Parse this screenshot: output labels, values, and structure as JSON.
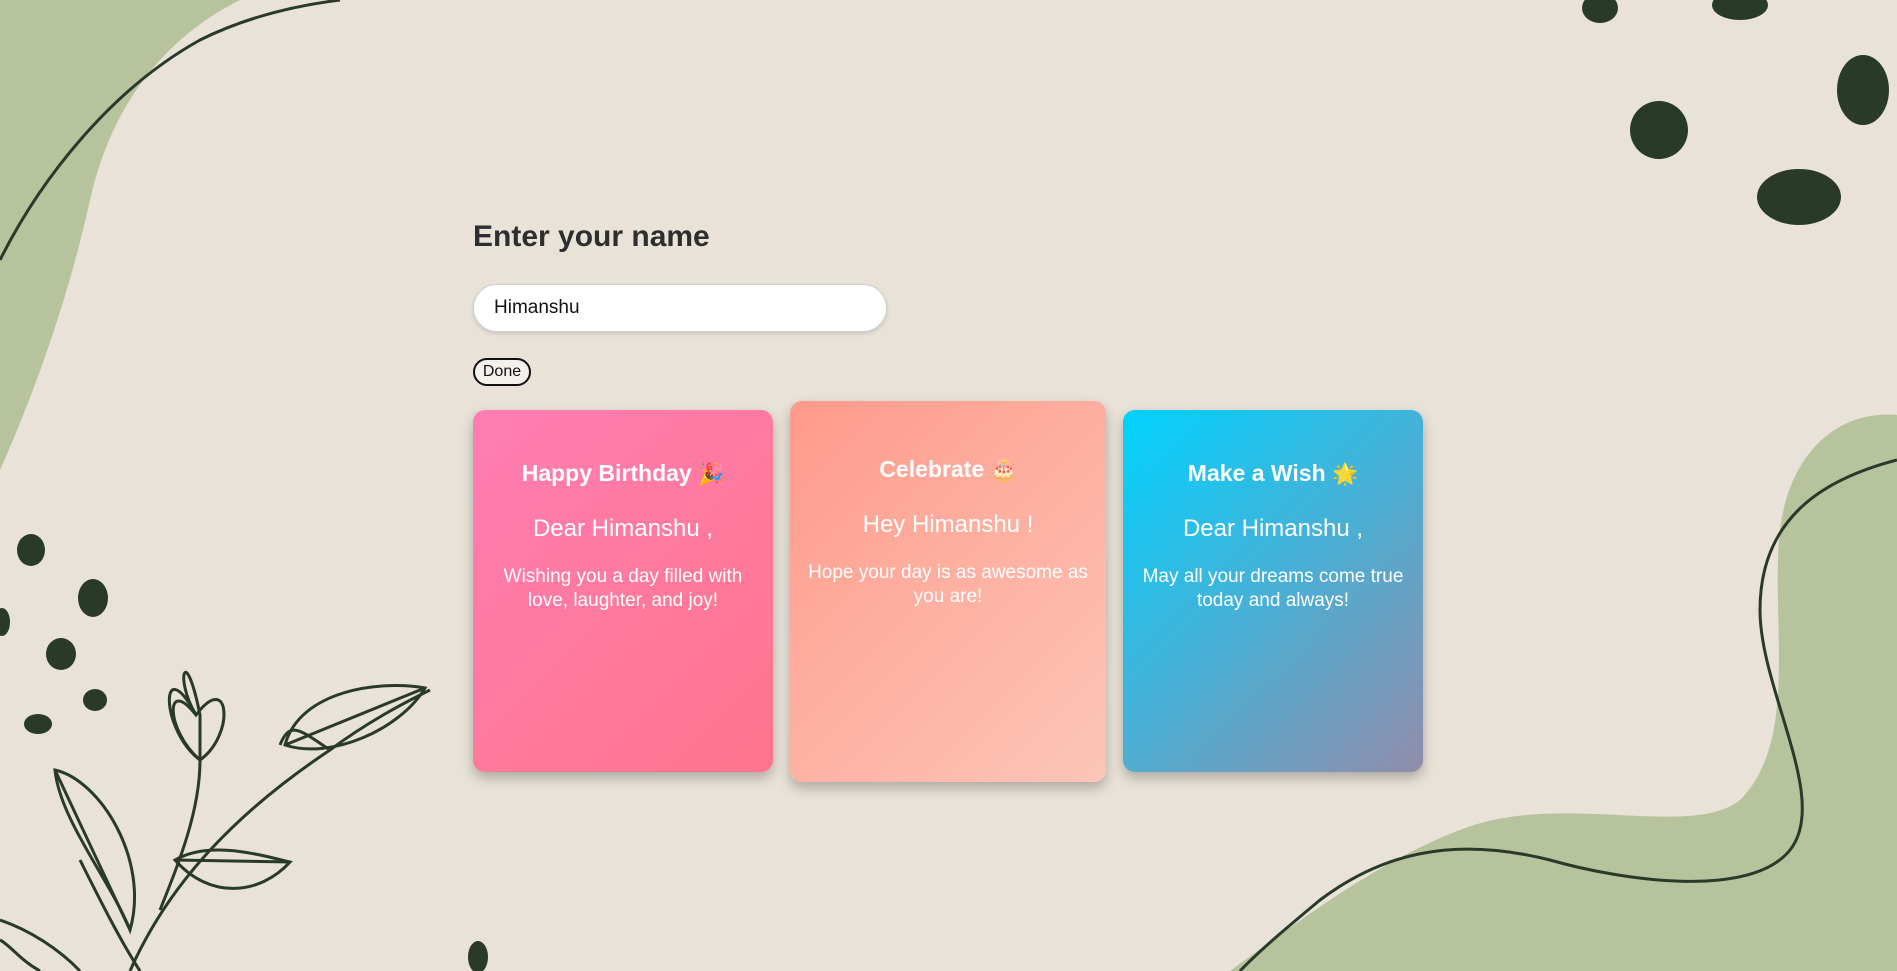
{
  "form": {
    "title": "Enter your name",
    "name_value": "Himanshu",
    "done_label": "Done"
  },
  "cards": [
    {
      "title": "Happy Birthday",
      "emoji": "🎉",
      "greeting": "Dear Himanshu ,",
      "message": "Wishing you a day filled with love, laughter, and joy!"
    },
    {
      "title": "Celebrate",
      "emoji": "🎂",
      "greeting": "Hey Himanshu !",
      "message": "Hope your day is as awesome as you are!"
    },
    {
      "title": "Make a Wish",
      "emoji": "🌟",
      "greeting": "Dear Himanshu ,",
      "message": "May all your dreams come true today and always!"
    }
  ],
  "colors": {
    "background": "#e8e2d8",
    "sage": "#b7c39c",
    "dark_green": "#2a3a2a"
  }
}
